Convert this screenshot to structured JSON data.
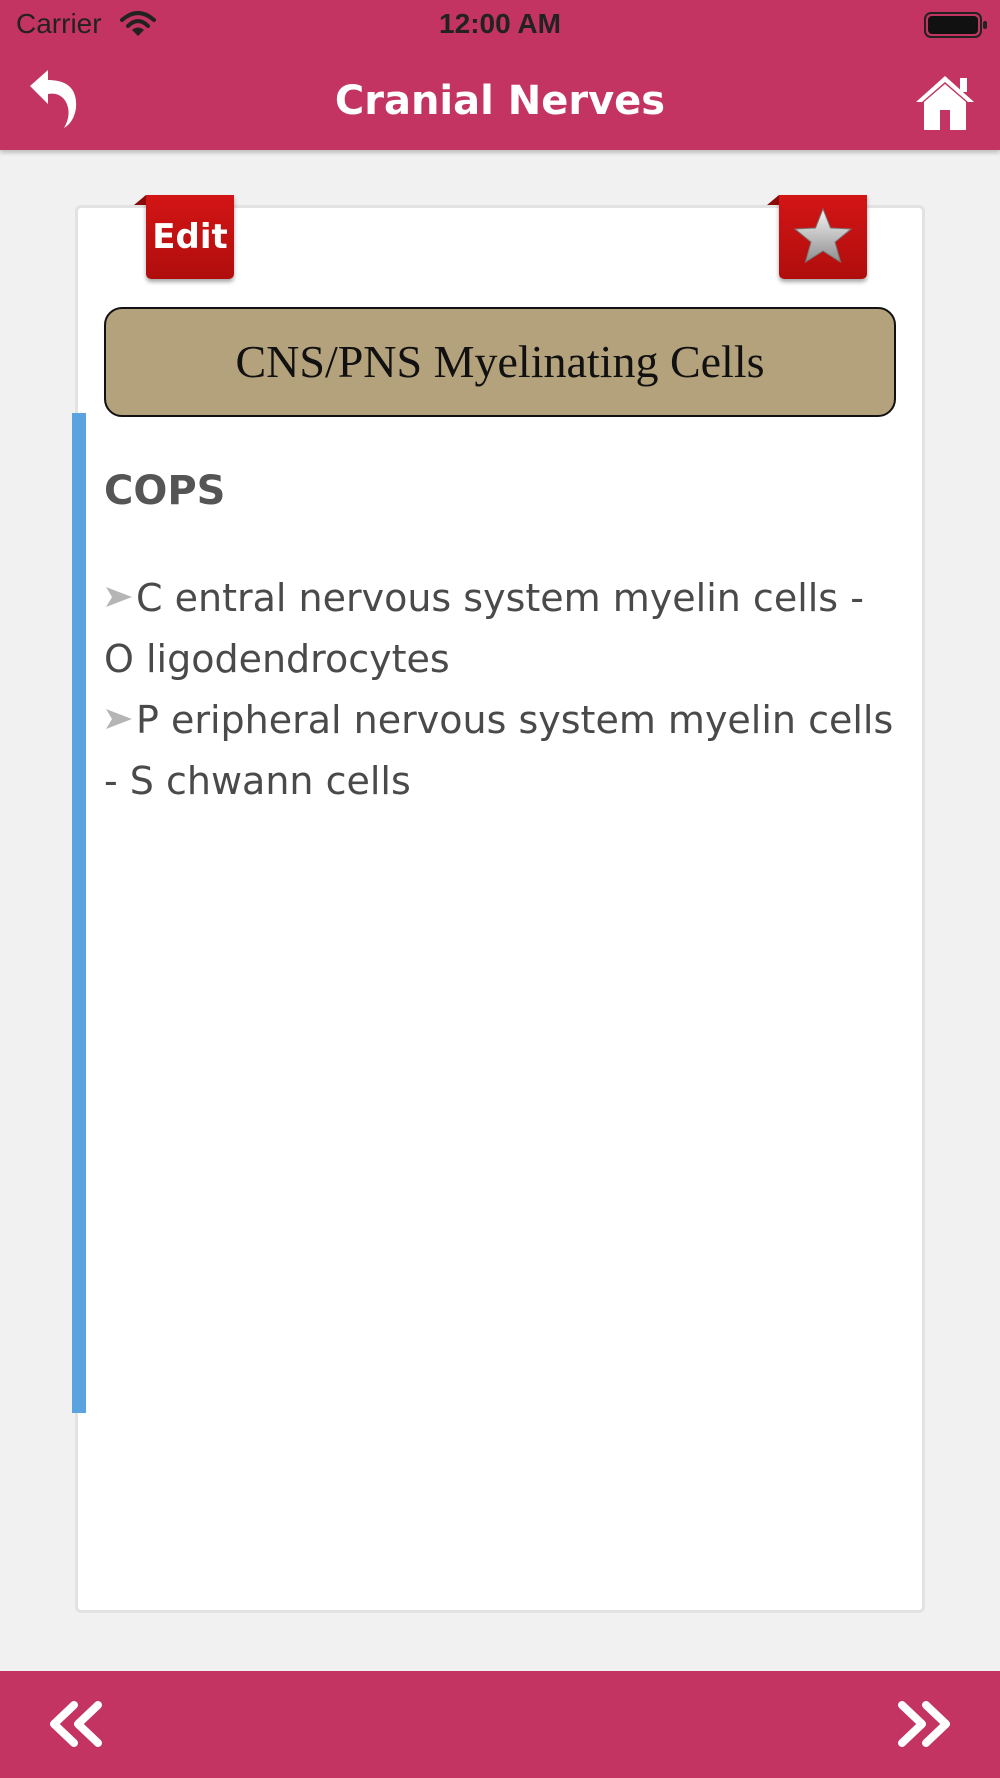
{
  "status_bar": {
    "carrier": "Carrier",
    "time": "12:00 AM",
    "wifi_icon": "wifi-icon",
    "battery_icon": "battery-icon"
  },
  "nav": {
    "title": "Cranial Nerves",
    "back_icon": "back-icon",
    "home_icon": "home-icon"
  },
  "card": {
    "edit_label": "Edit",
    "favorite_icon": "star-icon",
    "title": "CNS/PNS Myelinating Cells",
    "mnemonic": "COPS",
    "points": [
      "C entral nervous system myelin cells - O ligodendrocytes",
      "P eripheral nervous system myelin cells - S chwann cells"
    ]
  },
  "bottom_bar": {
    "prev_icon": "double-chevron-left-icon",
    "next_icon": "double-chevron-right-icon"
  },
  "colors": {
    "brand": "#c33462",
    "title_box": "#b3a27b",
    "accent_bar": "#5aa3e0",
    "tab_red": "#c81010"
  }
}
